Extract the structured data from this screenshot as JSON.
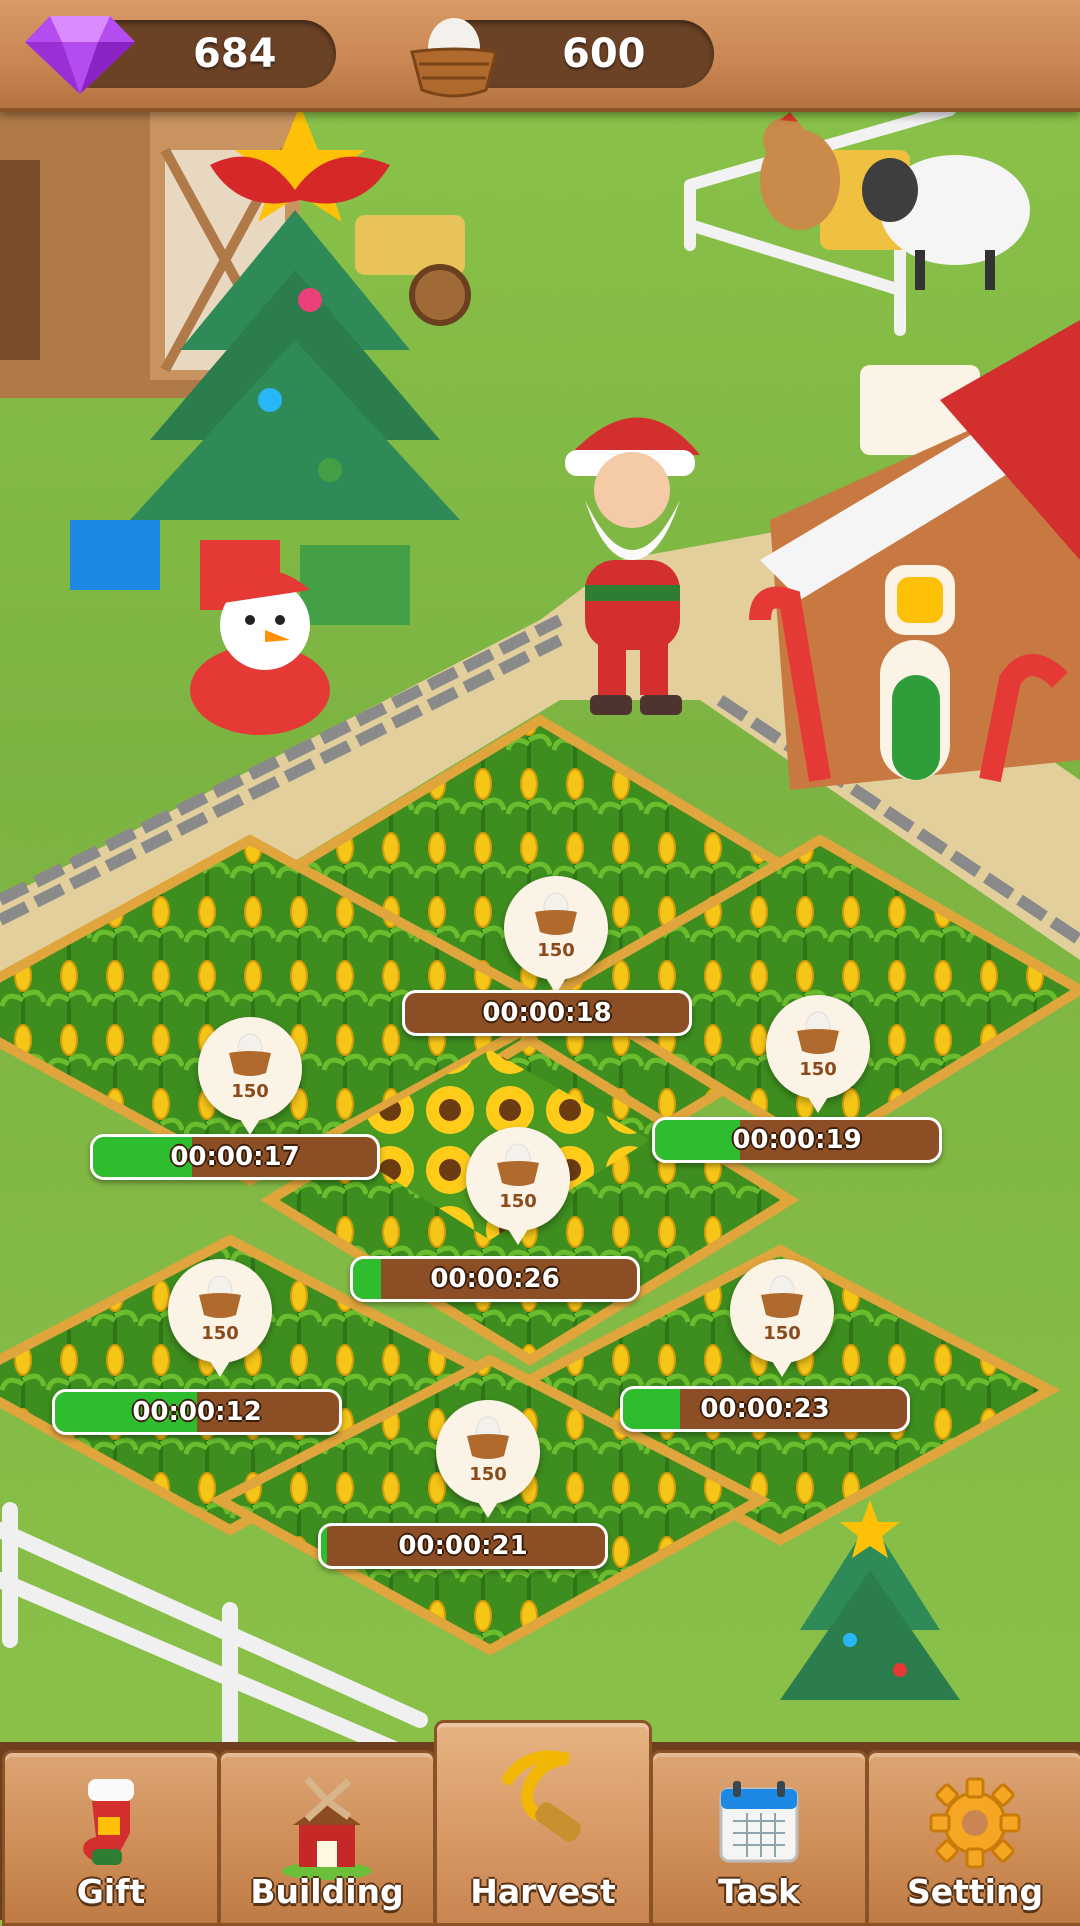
{
  "resources": {
    "gems": {
      "icon": "purple-gem-icon",
      "value": "684"
    },
    "eggs": {
      "icon": "egg-basket-icon",
      "value": "600"
    }
  },
  "plots": [
    {
      "id": "plot-top",
      "yield": "150",
      "timer": "00:00:18",
      "progress": 0.0
    },
    {
      "id": "plot-left",
      "yield": "150",
      "timer": "00:00:17",
      "progress": 0.35
    },
    {
      "id": "plot-right",
      "yield": "150",
      "timer": "00:00:19",
      "progress": 0.3
    },
    {
      "id": "plot-center",
      "yield": "150",
      "timer": "00:00:26",
      "progress": 0.1
    },
    {
      "id": "plot-bottom-left",
      "yield": "150",
      "timer": "00:00:12",
      "progress": 0.5
    },
    {
      "id": "plot-bottom-right",
      "yield": "150",
      "timer": "00:00:23",
      "progress": 0.2
    },
    {
      "id": "plot-bottom",
      "yield": "150",
      "timer": "00:00:21",
      "progress": 0.02
    }
  ],
  "tabs": [
    {
      "label": "Gift",
      "icon": "stocking-gift-icon"
    },
    {
      "label": "Building",
      "icon": "windmill-barn-icon"
    },
    {
      "label": "Harvest",
      "icon": "sickle-icon",
      "active": true
    },
    {
      "label": "Task",
      "icon": "calendar-icon"
    },
    {
      "label": "Setting",
      "icon": "gear-icon"
    }
  ],
  "colors": {
    "wood": "#c98552",
    "pill": "#6b4226",
    "grass": "#8bc34a",
    "timer_fill": "#2ebd2e",
    "timer_track": "#8c4e25"
  }
}
